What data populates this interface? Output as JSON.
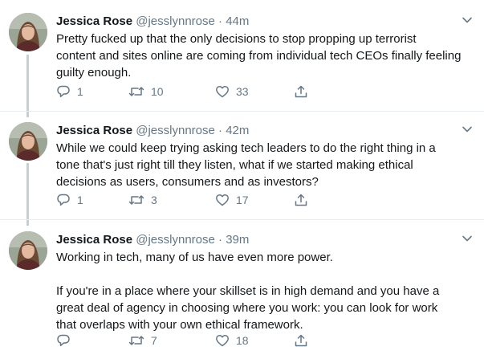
{
  "tweets": [
    {
      "name": "Jessica Rose",
      "handle": "@jesslynnrose",
      "separator": "·",
      "time": "44m",
      "text": "Pretty fucked up that the only decisions to stop propping up terrorist\ncontent and sites online are coming from individual tech CEOs finally feeling\nguilty enough.",
      "replies": "1",
      "retweets": "10",
      "likes": "33"
    },
    {
      "name": "Jessica Rose",
      "handle": "@jesslynnrose",
      "separator": "·",
      "time": "42m",
      "text": "While we could keep trying asking tech leaders to do the right thing in a\ntone that's just right till they listen, what if we started making ethical\ndecisions as users, consumers and as investors?",
      "replies": "1",
      "retweets": "3",
      "likes": "17"
    },
    {
      "name": "Jessica Rose",
      "handle": "@jesslynnrose",
      "separator": "·",
      "time": "39m",
      "text": "Working in tech, many of us have even more power.\n\nIf you're in a place where your skillset is in high demand and you have a\ngreat deal of agency in choosing where you work: you can look for work\nthat overlaps with your own ethical framework.",
      "replies": "",
      "retweets": "7",
      "likes": "18"
    }
  ],
  "icons": {
    "reply": "reply-icon",
    "retweet": "retweet-icon",
    "like": "heart-icon",
    "share": "share-icon",
    "caret": "chevron-down-icon"
  },
  "colors": {
    "text": "#14171a",
    "secondary": "#657786",
    "thread_line": "#c4cfd6",
    "divider": "#e6ecf0"
  }
}
